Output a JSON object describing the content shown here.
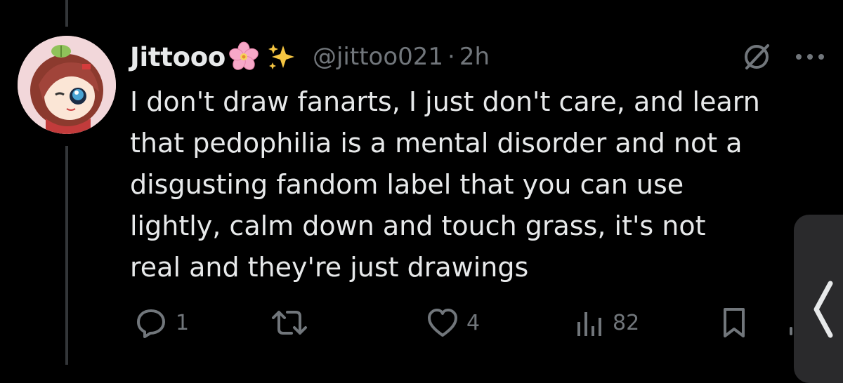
{
  "tweet": {
    "author_name": "Jittooo",
    "author_emojis": [
      "cherry-blossom",
      "sparkles"
    ],
    "handle": "@jittoo021",
    "separator": "·",
    "timestamp": "2h",
    "text": "I don't draw fanarts, I just don't care, and learn\nthat pedophilia is a mental disorder and not a\ndisgusting fandom label that you can use\nlightly, calm down and touch grass, it's not\nreal and they're just drawings"
  },
  "actions": {
    "reply_count": "1",
    "repost_count": "",
    "like_count": "4",
    "views_count": "82"
  },
  "colors": {
    "background": "#000000",
    "primary_text": "#e7e9ea",
    "secondary_text": "#71767b",
    "thread_line": "#333639",
    "side_panel": "#2a2a2c"
  },
  "icons": [
    "grok-icon",
    "more-icon",
    "reply-icon",
    "repost-icon",
    "like-icon",
    "views-icon",
    "bookmark-icon",
    "chevron-left-icon"
  ]
}
